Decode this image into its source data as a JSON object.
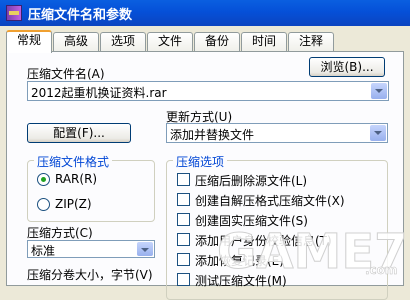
{
  "window": {
    "title": "压缩文件名和参数"
  },
  "tabs": [
    {
      "label": "常规"
    },
    {
      "label": "高级"
    },
    {
      "label": "选项"
    },
    {
      "label": "文件"
    },
    {
      "label": "备份"
    },
    {
      "label": "时间"
    },
    {
      "label": "注释"
    }
  ],
  "general": {
    "archive_name_label": "压缩文件名(A)",
    "archive_name_value": "2012起重机换证资料.rar",
    "browse_button": "浏览(B)...",
    "update_mode_label": "更新方式(U)",
    "update_mode_value": "添加并替换文件",
    "profiles_button": "配置(F)...",
    "format_group_title": "压缩文件格式",
    "format_rar": "RAR(R)",
    "format_zip": "ZIP(Z)",
    "format_selected": "RAR",
    "method_label": "压缩方式(C)",
    "method_partial": "标准",
    "split_label": "压缩分卷大小，字节(V)",
    "options_group_title": "压缩选项",
    "options": [
      {
        "label": "压缩后删除源文件(L)",
        "checked": false
      },
      {
        "label": "创建自解压格式压缩文件(X)",
        "checked": false
      },
      {
        "label": "创建固实压缩文件(S)",
        "checked": false
      },
      {
        "label": "添加用户身份校验信息(T)",
        "checked": false
      },
      {
        "label": "添加恢复记录(E)",
        "checked": false
      },
      {
        "label": "测试压缩文件(M)",
        "checked": false
      }
    ]
  },
  "watermark": {
    "text": "GAME773",
    "suffix": ".com"
  }
}
